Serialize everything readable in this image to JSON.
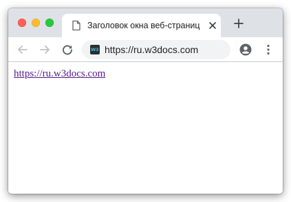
{
  "window": {
    "controls": [
      "close",
      "minimize",
      "zoom"
    ]
  },
  "tab": {
    "title": "Заголовок окна веб-страниц",
    "icon": "document-icon"
  },
  "toolbar": {
    "back_icon": "arrow-left-icon",
    "forward_icon": "arrow-right-icon",
    "reload_icon": "reload-icon",
    "url": "https://ru.w3docs.com",
    "favicon_text": "W3",
    "profile_icon": "account-icon",
    "menu_icon": "kebab-menu-icon"
  },
  "content": {
    "link_text": "https://ru.w3docs.com"
  },
  "colors": {
    "tabbar_bg": "#dee1e6",
    "link_visited": "#551a8b",
    "traffic_red": "#fe5f57",
    "traffic_yellow": "#febc2e",
    "traffic_green": "#28c840"
  }
}
